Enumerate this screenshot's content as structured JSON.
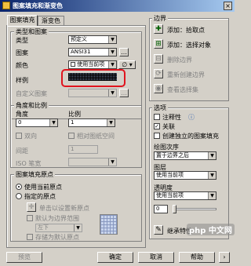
{
  "title": "图案填充和渐变色",
  "close_glyph": "×",
  "tabs": [
    "图案填充",
    "渐变色"
  ],
  "type_pattern": {
    "group": "类型和图案",
    "type_label": "类型",
    "type_value": "预定义",
    "pattern_label": "图案",
    "pattern_value": "ANSI31",
    "color_label": "颜色",
    "color_value": "使用当前项",
    "swatch_label": "样例",
    "custom_label": "自定义图案"
  },
  "angle_scale": {
    "group": "角度和比例",
    "angle_label": "角度",
    "angle_value": "0",
    "scale_label": "比例",
    "scale_value": "1",
    "double_label": "双向",
    "relative_label": "相对图纸空间",
    "spacing_label": "间距",
    "spacing_value": "1",
    "iso_label": "ISO 笔宽"
  },
  "origin": {
    "group": "图案填充原点",
    "use_current": "使用当前原点",
    "specified": "指定的原点",
    "click_set": "单击以设置新原点",
    "default_extents": "默认为边界范围",
    "position_value": "左下",
    "store_default": "存储为默认原点"
  },
  "boundaries": {
    "group": "边界",
    "add_pick": "添加：拾取点",
    "add_select": "添加：选择对象",
    "remove": "删除边界",
    "recreate": "重新创建边界",
    "view": "查看选择集"
  },
  "options": {
    "group": "选项",
    "annotative": "注释性",
    "associative": "关联",
    "separate": "创建独立的图案填充",
    "draw_order_label": "绘图次序",
    "draw_order_value": "置于边界之后",
    "layer_label": "图层",
    "layer_value": "使用当前项",
    "transparency_label": "透明度",
    "transparency_value": "使用当前项",
    "transparency_number": "0",
    "inherit": "继承特性"
  },
  "bottom": {
    "preview": "预览",
    "ok": "确定",
    "cancel": "取消",
    "help": "帮助"
  },
  "watermark": "php 中文网",
  "colors": {
    "highlight_box": "#e0141e",
    "title_bar": "#0a246a"
  }
}
